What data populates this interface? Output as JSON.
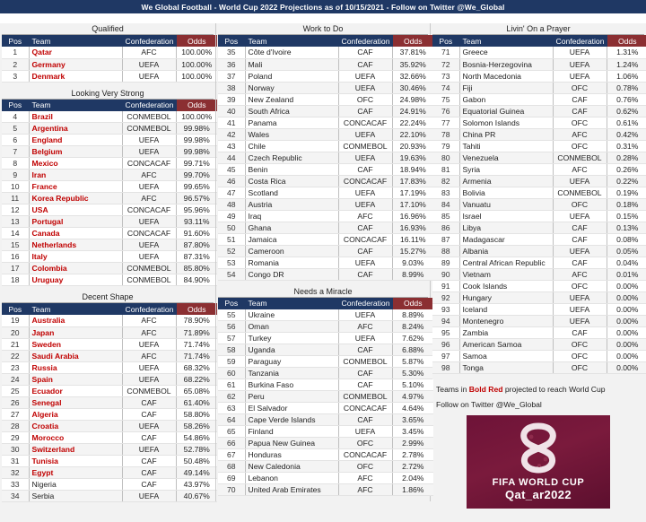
{
  "titlebar": {
    "text": "We Global Football - World Cup 2022 Projections as of 10/15/2021 - Follow on Twitter @We_Global"
  },
  "columns": {
    "headers": {
      "pos": "Pos",
      "team": "Team",
      "confederation": "Confederation",
      "odds": "Odds"
    },
    "left": [
      {
        "title": "Qualified",
        "rows": [
          {
            "pos": "1",
            "team": "Qatar",
            "conf": "AFC",
            "odds": "100.00%",
            "q": true
          },
          {
            "pos": "2",
            "team": "Germany",
            "conf": "UEFA",
            "odds": "100.00%",
            "q": true
          },
          {
            "pos": "3",
            "team": "Denmark",
            "conf": "UEFA",
            "odds": "100.00%",
            "q": true
          }
        ]
      },
      {
        "title": "Looking Very Strong",
        "rows": [
          {
            "pos": "4",
            "team": "Brazil",
            "conf": "CONMEBOL",
            "odds": "100.00%",
            "q": true
          },
          {
            "pos": "5",
            "team": "Argentina",
            "conf": "CONMEBOL",
            "odds": "99.98%",
            "q": true
          },
          {
            "pos": "6",
            "team": "England",
            "conf": "UEFA",
            "odds": "99.98%",
            "q": true
          },
          {
            "pos": "7",
            "team": "Belgium",
            "conf": "UEFA",
            "odds": "99.98%",
            "q": true
          },
          {
            "pos": "8",
            "team": "Mexico",
            "conf": "CONCACAF",
            "odds": "99.71%",
            "q": true
          },
          {
            "pos": "9",
            "team": "Iran",
            "conf": "AFC",
            "odds": "99.70%",
            "q": true
          },
          {
            "pos": "10",
            "team": "France",
            "conf": "UEFA",
            "odds": "99.65%",
            "q": true
          },
          {
            "pos": "11",
            "team": "Korea Republic",
            "conf": "AFC",
            "odds": "96.57%",
            "q": true
          },
          {
            "pos": "12",
            "team": "USA",
            "conf": "CONCACAF",
            "odds": "95.96%",
            "q": true
          },
          {
            "pos": "13",
            "team": "Portugal",
            "conf": "UEFA",
            "odds": "93.11%",
            "q": true
          },
          {
            "pos": "14",
            "team": "Canada",
            "conf": "CONCACAF",
            "odds": "91.60%",
            "q": true
          },
          {
            "pos": "15",
            "team": "Netherlands",
            "conf": "UEFA",
            "odds": "87.80%",
            "q": true
          },
          {
            "pos": "16",
            "team": "Italy",
            "conf": "UEFA",
            "odds": "87.31%",
            "q": true
          },
          {
            "pos": "17",
            "team": "Colombia",
            "conf": "CONMEBOL",
            "odds": "85.80%",
            "q": true
          },
          {
            "pos": "18",
            "team": "Uruguay",
            "conf": "CONMEBOL",
            "odds": "84.90%",
            "q": true
          }
        ]
      },
      {
        "title": "Decent Shape",
        "rows": [
          {
            "pos": "19",
            "team": "Australia",
            "conf": "AFC",
            "odds": "78.90%",
            "q": true
          },
          {
            "pos": "20",
            "team": "Japan",
            "conf": "AFC",
            "odds": "71.89%",
            "q": true
          },
          {
            "pos": "21",
            "team": "Sweden",
            "conf": "UEFA",
            "odds": "71.74%",
            "q": true
          },
          {
            "pos": "22",
            "team": "Saudi Arabia",
            "conf": "AFC",
            "odds": "71.74%",
            "q": true
          },
          {
            "pos": "23",
            "team": "Russia",
            "conf": "UEFA",
            "odds": "68.32%",
            "q": true
          },
          {
            "pos": "24",
            "team": "Spain",
            "conf": "UEFA",
            "odds": "68.22%",
            "q": true
          },
          {
            "pos": "25",
            "team": "Ecuador",
            "conf": "CONMEBOL",
            "odds": "65.08%",
            "q": true
          },
          {
            "pos": "26",
            "team": "Senegal",
            "conf": "CAF",
            "odds": "61.40%",
            "q": true
          },
          {
            "pos": "27",
            "team": "Algeria",
            "conf": "CAF",
            "odds": "58.80%",
            "q": true
          },
          {
            "pos": "28",
            "team": "Croatia",
            "conf": "UEFA",
            "odds": "58.26%",
            "q": true
          },
          {
            "pos": "29",
            "team": "Morocco",
            "conf": "CAF",
            "odds": "54.86%",
            "q": true
          },
          {
            "pos": "30",
            "team": "Switzerland",
            "conf": "UEFA",
            "odds": "52.78%",
            "q": true
          },
          {
            "pos": "31",
            "team": "Tunisia",
            "conf": "CAF",
            "odds": "50.48%",
            "q": true
          },
          {
            "pos": "32",
            "team": "Egypt",
            "conf": "CAF",
            "odds": "49.14%",
            "q": true
          },
          {
            "pos": "33",
            "team": "Nigeria",
            "conf": "CAF",
            "odds": "43.97%",
            "q": false
          },
          {
            "pos": "34",
            "team": "Serbia",
            "conf": "UEFA",
            "odds": "40.67%",
            "q": false
          }
        ]
      }
    ],
    "middle": [
      {
        "title": "Work to Do",
        "rows": [
          {
            "pos": "35",
            "team": "Côte d'Ivoire",
            "conf": "CAF",
            "odds": "37.81%",
            "q": false
          },
          {
            "pos": "36",
            "team": "Mali",
            "conf": "CAF",
            "odds": "35.92%",
            "q": false
          },
          {
            "pos": "37",
            "team": "Poland",
            "conf": "UEFA",
            "odds": "32.66%",
            "q": false
          },
          {
            "pos": "38",
            "team": "Norway",
            "conf": "UEFA",
            "odds": "30.46%",
            "q": false
          },
          {
            "pos": "39",
            "team": "New Zealand",
            "conf": "OFC",
            "odds": "24.98%",
            "q": false
          },
          {
            "pos": "40",
            "team": "South Africa",
            "conf": "CAF",
            "odds": "24.91%",
            "q": false
          },
          {
            "pos": "41",
            "team": "Panama",
            "conf": "CONCACAF",
            "odds": "22.24%",
            "q": false
          },
          {
            "pos": "42",
            "team": "Wales",
            "conf": "UEFA",
            "odds": "22.10%",
            "q": false
          },
          {
            "pos": "43",
            "team": "Chile",
            "conf": "CONMEBOL",
            "odds": "20.93%",
            "q": false
          },
          {
            "pos": "44",
            "team": "Czech Republic",
            "conf": "UEFA",
            "odds": "19.63%",
            "q": false
          },
          {
            "pos": "45",
            "team": "Benin",
            "conf": "CAF",
            "odds": "18.94%",
            "q": false
          },
          {
            "pos": "46",
            "team": "Costa Rica",
            "conf": "CONCACAF",
            "odds": "17.83%",
            "q": false
          },
          {
            "pos": "47",
            "team": "Scotland",
            "conf": "UEFA",
            "odds": "17.19%",
            "q": false
          },
          {
            "pos": "48",
            "team": "Austria",
            "conf": "UEFA",
            "odds": "17.10%",
            "q": false
          },
          {
            "pos": "49",
            "team": "Iraq",
            "conf": "AFC",
            "odds": "16.96%",
            "q": false
          },
          {
            "pos": "50",
            "team": "Ghana",
            "conf": "CAF",
            "odds": "16.93%",
            "q": false
          },
          {
            "pos": "51",
            "team": "Jamaica",
            "conf": "CONCACAF",
            "odds": "16.11%",
            "q": false
          },
          {
            "pos": "52",
            "team": "Cameroon",
            "conf": "CAF",
            "odds": "15.27%",
            "q": false
          },
          {
            "pos": "53",
            "team": "Romania",
            "conf": "UEFA",
            "odds": "9.03%",
            "q": false
          },
          {
            "pos": "54",
            "team": "Congo DR",
            "conf": "CAF",
            "odds": "8.99%",
            "q": false
          }
        ]
      },
      {
        "title": "Needs a Miracle",
        "rows": [
          {
            "pos": "55",
            "team": "Ukraine",
            "conf": "UEFA",
            "odds": "8.89%",
            "q": false
          },
          {
            "pos": "56",
            "team": "Oman",
            "conf": "AFC",
            "odds": "8.24%",
            "q": false
          },
          {
            "pos": "57",
            "team": "Turkey",
            "conf": "UEFA",
            "odds": "7.62%",
            "q": false
          },
          {
            "pos": "58",
            "team": "Uganda",
            "conf": "CAF",
            "odds": "6.88%",
            "q": false
          },
          {
            "pos": "59",
            "team": "Paraguay",
            "conf": "CONMEBOL",
            "odds": "5.87%",
            "q": false
          },
          {
            "pos": "60",
            "team": "Tanzania",
            "conf": "CAF",
            "odds": "5.30%",
            "q": false
          },
          {
            "pos": "61",
            "team": "Burkina Faso",
            "conf": "CAF",
            "odds": "5.10%",
            "q": false
          },
          {
            "pos": "62",
            "team": "Peru",
            "conf": "CONMEBOL",
            "odds": "4.97%",
            "q": false
          },
          {
            "pos": "63",
            "team": "El Salvador",
            "conf": "CONCACAF",
            "odds": "4.64%",
            "q": false
          },
          {
            "pos": "64",
            "team": "Cape Verde Islands",
            "conf": "CAF",
            "odds": "3.65%",
            "q": false
          },
          {
            "pos": "65",
            "team": "Finland",
            "conf": "UEFA",
            "odds": "3.45%",
            "q": false
          },
          {
            "pos": "66",
            "team": "Papua New Guinea",
            "conf": "OFC",
            "odds": "2.99%",
            "q": false
          },
          {
            "pos": "67",
            "team": "Honduras",
            "conf": "CONCACAF",
            "odds": "2.78%",
            "q": false
          },
          {
            "pos": "68",
            "team": "New Caledonia",
            "conf": "OFC",
            "odds": "2.72%",
            "q": false
          },
          {
            "pos": "69",
            "team": "Lebanon",
            "conf": "AFC",
            "odds": "2.04%",
            "q": false
          },
          {
            "pos": "70",
            "team": "United Arab Emirates",
            "conf": "AFC",
            "odds": "1.86%",
            "q": false
          }
        ]
      }
    ],
    "right": [
      {
        "title": "Livin' On a Prayer",
        "rows": [
          {
            "pos": "71",
            "team": "Greece",
            "conf": "UEFA",
            "odds": "1.31%",
            "q": false
          },
          {
            "pos": "72",
            "team": "Bosnia-Herzegovina",
            "conf": "UEFA",
            "odds": "1.24%",
            "q": false
          },
          {
            "pos": "73",
            "team": "North Macedonia",
            "conf": "UEFA",
            "odds": "1.06%",
            "q": false
          },
          {
            "pos": "74",
            "team": "Fiji",
            "conf": "OFC",
            "odds": "0.78%",
            "q": false
          },
          {
            "pos": "75",
            "team": "Gabon",
            "conf": "CAF",
            "odds": "0.76%",
            "q": false
          },
          {
            "pos": "76",
            "team": "Equatorial Guinea",
            "conf": "CAF",
            "odds": "0.62%",
            "q": false
          },
          {
            "pos": "77",
            "team": "Solomon Islands",
            "conf": "OFC",
            "odds": "0.61%",
            "q": false
          },
          {
            "pos": "78",
            "team": "China PR",
            "conf": "AFC",
            "odds": "0.42%",
            "q": false
          },
          {
            "pos": "79",
            "team": "Tahiti",
            "conf": "OFC",
            "odds": "0.31%",
            "q": false
          },
          {
            "pos": "80",
            "team": "Venezuela",
            "conf": "CONMEBOL",
            "odds": "0.28%",
            "q": false
          },
          {
            "pos": "81",
            "team": "Syria",
            "conf": "AFC",
            "odds": "0.26%",
            "q": false
          },
          {
            "pos": "82",
            "team": "Armenia",
            "conf": "UEFA",
            "odds": "0.22%",
            "q": false
          },
          {
            "pos": "83",
            "team": "Bolivia",
            "conf": "CONMEBOL",
            "odds": "0.19%",
            "q": false
          },
          {
            "pos": "84",
            "team": "Vanuatu",
            "conf": "OFC",
            "odds": "0.18%",
            "q": false
          },
          {
            "pos": "85",
            "team": "Israel",
            "conf": "UEFA",
            "odds": "0.15%",
            "q": false
          },
          {
            "pos": "86",
            "team": "Libya",
            "conf": "CAF",
            "odds": "0.13%",
            "q": false
          },
          {
            "pos": "87",
            "team": "Madagascar",
            "conf": "CAF",
            "odds": "0.08%",
            "q": false
          },
          {
            "pos": "88",
            "team": "Albania",
            "conf": "UEFA",
            "odds": "0.05%",
            "q": false
          },
          {
            "pos": "89",
            "team": "Central African Republic",
            "conf": "CAF",
            "odds": "0.04%",
            "q": false
          },
          {
            "pos": "90",
            "team": "Vietnam",
            "conf": "AFC",
            "odds": "0.01%",
            "q": false
          },
          {
            "pos": "91",
            "team": "Cook Islands",
            "conf": "OFC",
            "odds": "0.00%",
            "q": false
          },
          {
            "pos": "92",
            "team": "Hungary",
            "conf": "UEFA",
            "odds": "0.00%",
            "q": false
          },
          {
            "pos": "93",
            "team": "Iceland",
            "conf": "UEFA",
            "odds": "0.00%",
            "q": false
          },
          {
            "pos": "94",
            "team": "Montenegro",
            "conf": "UEFA",
            "odds": "0.00%",
            "q": false
          },
          {
            "pos": "95",
            "team": "Zambia",
            "conf": "CAF",
            "odds": "0.00%",
            "q": false
          },
          {
            "pos": "96",
            "team": "American Samoa",
            "conf": "OFC",
            "odds": "0.00%",
            "q": false
          },
          {
            "pos": "97",
            "team": "Samoa",
            "conf": "OFC",
            "odds": "0.00%",
            "q": false
          },
          {
            "pos": "98",
            "team": "Tonga",
            "conf": "OFC",
            "odds": "0.00%",
            "q": false
          }
        ]
      }
    ]
  },
  "legend": {
    "line1_before": "Teams in ",
    "line1_highlight": "Bold Red",
    "line1_after": " projected to reach World Cup",
    "line2": "Follow on Twitter @We_Global"
  },
  "logo": {
    "line1": "FIFA WORLD CUP",
    "line2": "Qat_ar2022"
  },
  "colors": {
    "header_navy": "#1F3864",
    "odds_maroon": "#8B2F32",
    "qualified_red": "#C00000",
    "logo_maroon": "#6E1338"
  }
}
